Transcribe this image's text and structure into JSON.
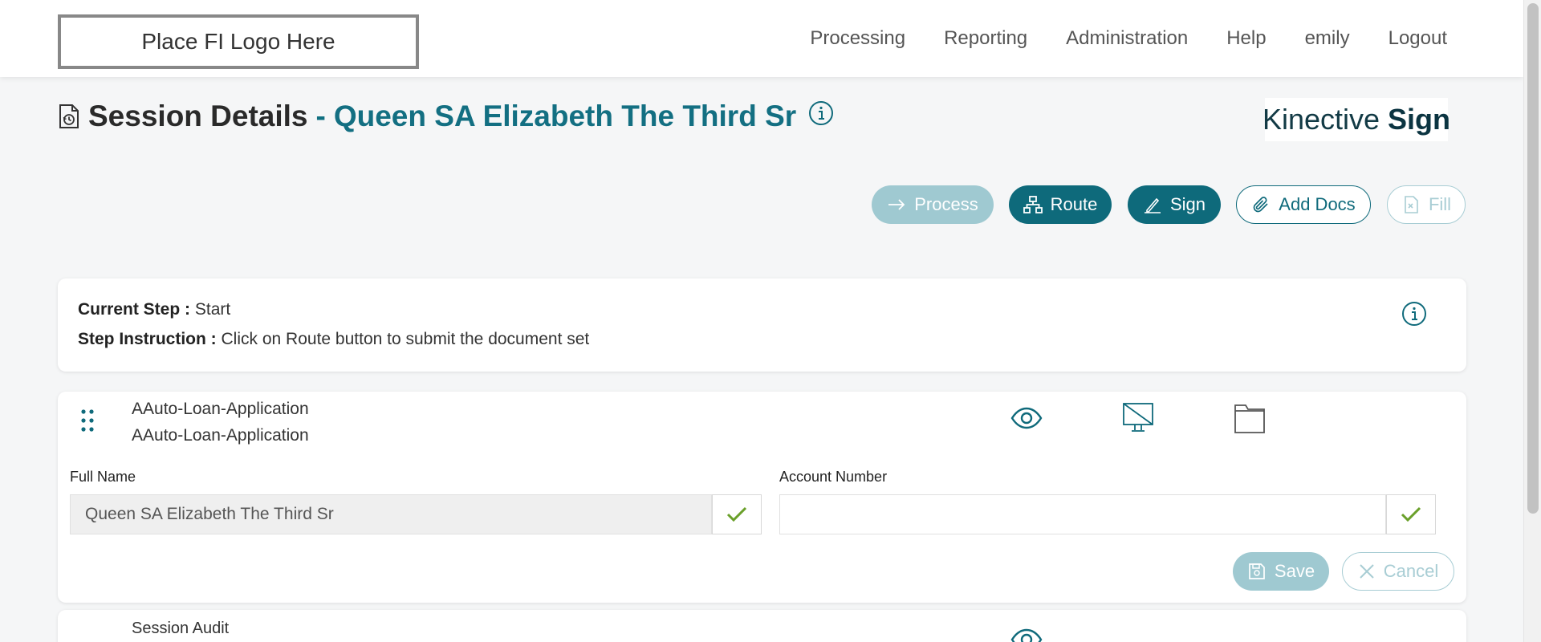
{
  "header": {
    "logo_text": "Place FI Logo Here",
    "nav": [
      "Processing",
      "Reporting",
      "Administration",
      "Help",
      "emily",
      "Logout"
    ]
  },
  "title": {
    "page_title": "Session Details",
    "dash": "-",
    "session_name": "Queen SA Elizabeth The Third Sr",
    "icon": "history-doc-icon",
    "info_icon": "info-icon"
  },
  "brand": {
    "part1": "Kinective",
    "part2": "Sign"
  },
  "actions": {
    "process": "Process",
    "route": "Route",
    "sign": "Sign",
    "add_docs": "Add Docs",
    "fill": "Fill"
  },
  "step": {
    "current_label": "Current Step :",
    "current_value": "Start",
    "instruction_label": "Step Instruction :",
    "instruction_value": "Click on Route button to submit the document set"
  },
  "document": {
    "name_line1": "AAuto-Loan-Application",
    "name_line2": "AAuto-Loan-Application",
    "icons": [
      "eye-icon",
      "no-display-icon",
      "folder-icon"
    ],
    "fields": {
      "full_name_label": "Full Name",
      "full_name_value": "Queen SA Elizabeth The Third Sr",
      "account_label": "Account Number",
      "account_value": ""
    },
    "save": "Save",
    "cancel": "Cancel"
  },
  "audit": {
    "name": "Session Audit"
  },
  "colors": {
    "primary": "#0e6a7b",
    "primary_light": "#9fc9d1",
    "check_green": "#6aa02a"
  }
}
